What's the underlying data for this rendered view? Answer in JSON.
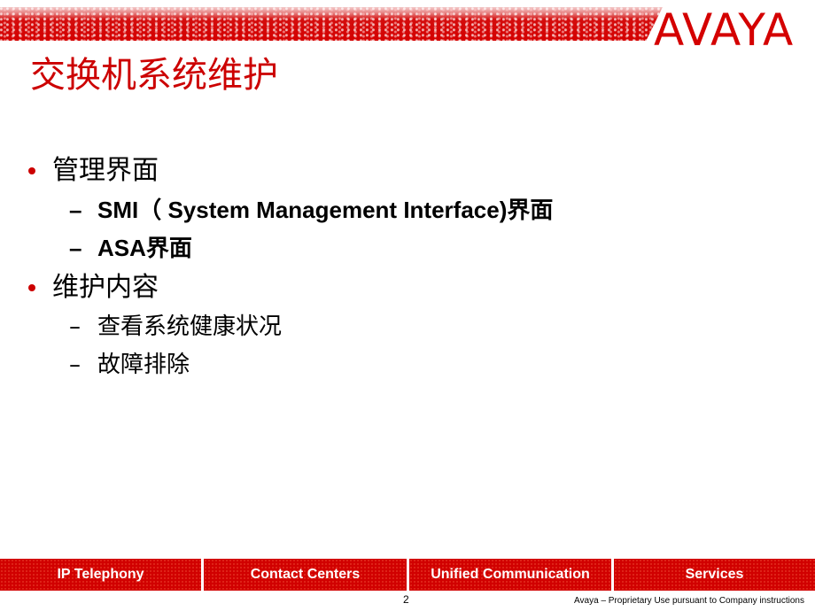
{
  "brand": {
    "logo_text": "AVAYA",
    "accent_color": "#d40000"
  },
  "slide": {
    "title": "交换机系统维护",
    "bullets": [
      {
        "label": "管理界面",
        "subitems": [
          {
            "label": "SMI（ System Management Interface)界面"
          },
          {
            "label": "ASA界面"
          }
        ]
      },
      {
        "label": "维护内容",
        "subitems": [
          {
            "label": "查看系统健康状况"
          },
          {
            "label": "故障排除"
          }
        ]
      }
    ],
    "bullet_glyph": "•",
    "dash_glyph": "–"
  },
  "footer": {
    "tabs": [
      {
        "label": "IP Telephony"
      },
      {
        "label": "Contact Centers"
      },
      {
        "label": "Unified Communication"
      },
      {
        "label": "Services"
      }
    ],
    "page_number": "2",
    "legal": "Avaya – Proprietary   Use pursuant to Company instructions"
  }
}
